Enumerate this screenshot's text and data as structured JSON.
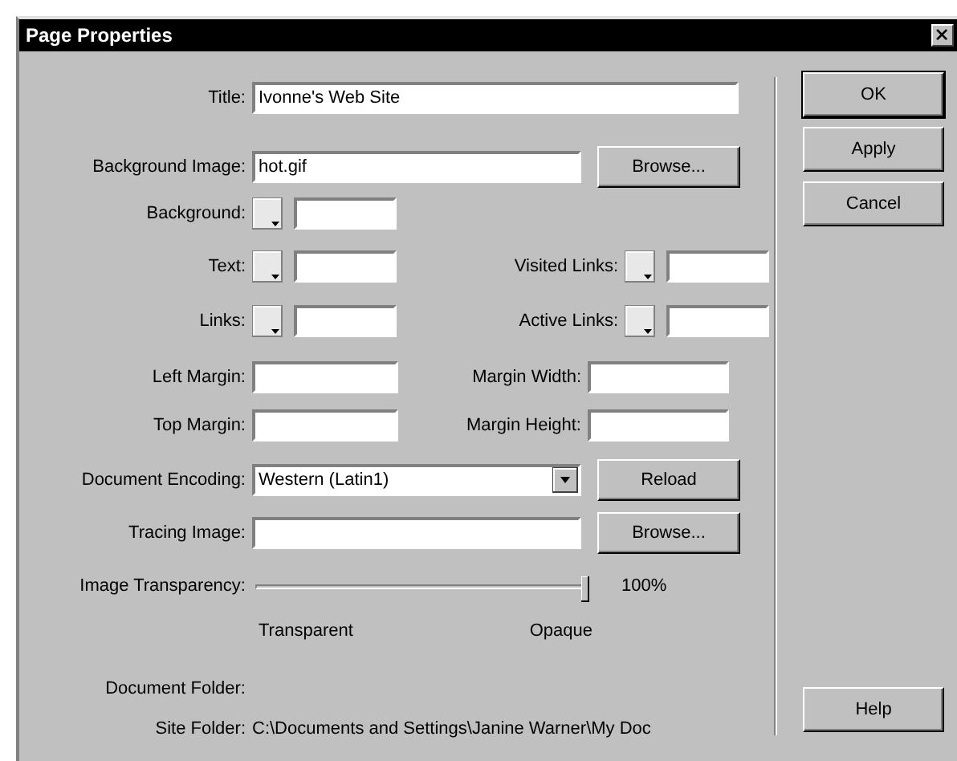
{
  "window": {
    "title": "Page Properties"
  },
  "title_field": {
    "label": "Title:",
    "value": "Ivonne's Web Site"
  },
  "background_image": {
    "label": "Background Image:",
    "value": "hot.gif",
    "button": "Browse..."
  },
  "color_rows": [
    {
      "left": {
        "label": "Background:"
      }
    },
    {
      "left": {
        "label": "Text:"
      },
      "right": {
        "label": "Visited Links:"
      }
    },
    {
      "left": {
        "label": "Links:"
      },
      "right": {
        "label": "Active Links:"
      }
    }
  ],
  "margin_rows": [
    {
      "left": {
        "label": "Left Margin:"
      },
      "right": {
        "label": "Margin Width:"
      }
    },
    {
      "left": {
        "label": "Top Margin:"
      },
      "right": {
        "label": "Margin Height:"
      }
    }
  ],
  "document_encoding": {
    "label": "Document Encoding:",
    "value": "Western (Latin1)",
    "button": "Reload"
  },
  "tracing_image": {
    "label": "Tracing Image:",
    "button": "Browse..."
  },
  "image_transparency": {
    "label": "Image Transparency:",
    "level": 1,
    "reading": "100%",
    "min_label": "Transparent",
    "max_label": "Opaque"
  },
  "document_folder": {
    "label": "Document Folder:"
  },
  "site_folder": {
    "label": "Site Folder:",
    "value": "C:\\Documents and Settings\\Janine Warner\\My Doc"
  },
  "buttons": [
    {
      "label": "OK",
      "default": true
    },
    {
      "label": "Apply",
      "default": false
    },
    {
      "label": "Cancel",
      "default": false
    }
  ],
  "help_button": "Help"
}
